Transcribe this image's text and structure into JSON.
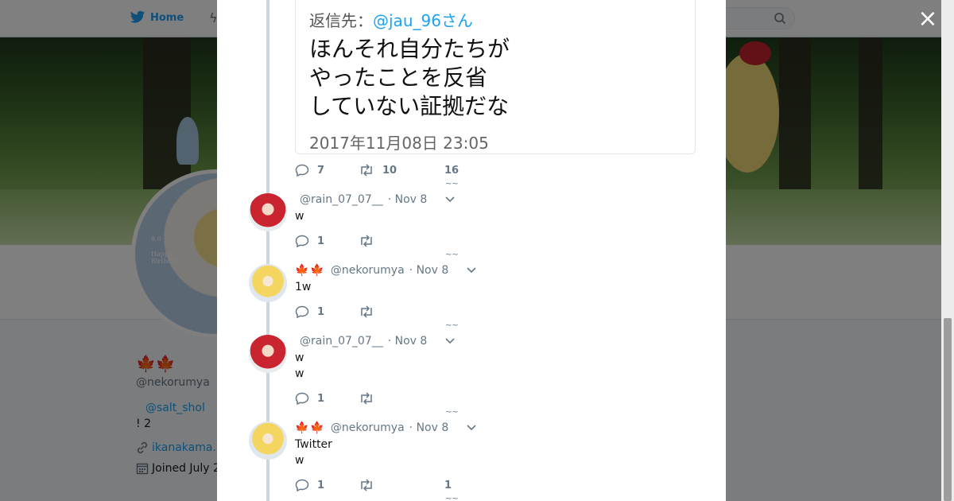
{
  "background": {
    "nav": {
      "home_label": "Home"
    },
    "profile": {
      "name": "🍁🍁",
      "handle": "@nekorumya",
      "mention": "@salt_shol",
      "bio": "! 2",
      "link": "ikanakama.",
      "joined": "Joined July 2",
      "avatar_text_line1": "8.0",
      "avatar_text_line2": "Happy",
      "avatar_text_line3": "Birthday"
    }
  },
  "modal": {
    "embedded_image": {
      "reply_prefix": "返信先：",
      "reply_mention": "@jau_96さん",
      "text_lines": [
        "ほんそれ自分たちが",
        "やったことを反省",
        "していない証拠だな"
      ],
      "date": "2017年11月08日 23:05"
    },
    "main_actions": {
      "replies": "7",
      "retweets": "10",
      "likes": "16"
    },
    "tweets": [
      {
        "name": "",
        "handle": "@rain_07_07__",
        "time": "· Nov 8",
        "lines": [
          "w"
        ],
        "replies": "1",
        "retweets": "",
        "likes": ""
      },
      {
        "name": "🍁🍁",
        "handle": "@nekorumya",
        "time": "· Nov 8",
        "lines": [
          "1w"
        ],
        "replies": "1",
        "retweets": "",
        "likes": ""
      },
      {
        "name": "",
        "handle": "@rain_07_07__",
        "time": "· Nov 8",
        "lines": [
          "w",
          "w"
        ],
        "replies": "1",
        "retweets": "",
        "likes": ""
      },
      {
        "name": "🍁🍁",
        "handle": "@nekorumya",
        "time": "· Nov 8",
        "lines": [
          "Twitter",
          "w"
        ],
        "replies": "1",
        "retweets": "",
        "likes": "1"
      }
    ]
  },
  "icons": {
    "close": "×",
    "tilde": "~~"
  },
  "colors": {
    "accent": "#1da1f2",
    "leaf": "#d1202a"
  }
}
